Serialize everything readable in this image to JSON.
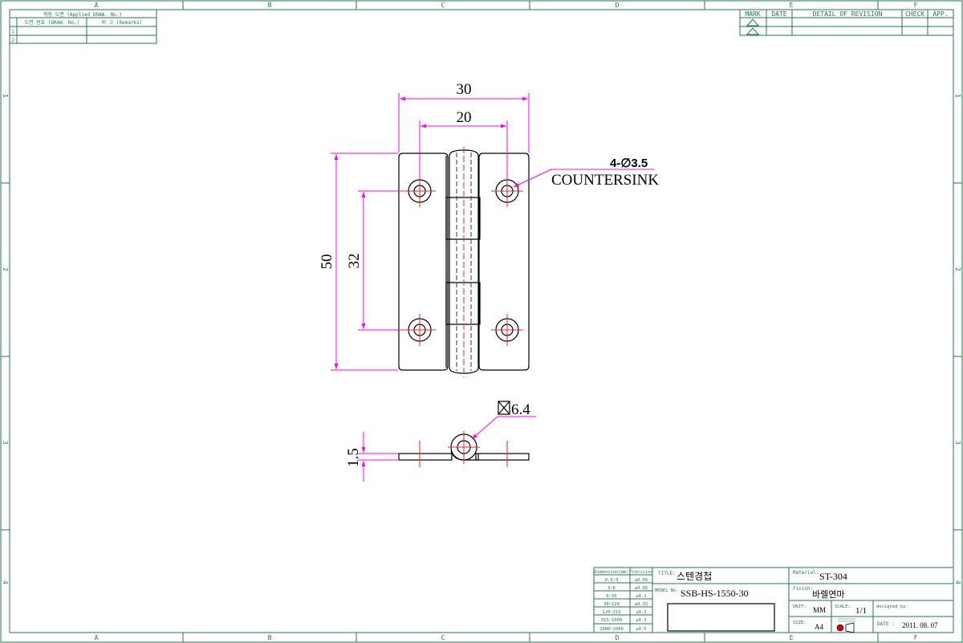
{
  "border": {
    "col_labels": [
      "A",
      "B",
      "C",
      "D",
      "E",
      "F"
    ],
    "row_labels": [
      "1",
      "2",
      "3",
      "4"
    ]
  },
  "applied_table": {
    "header": "적용 도면 (Applied DRAW. No.)",
    "col1": "도면 번호 (DRAW. No.)",
    "col2": "비 고 (Remarks)",
    "rows": [
      "1",
      "2"
    ]
  },
  "revision_table": {
    "headers": [
      "MARK",
      "DATE",
      "DETAIL OF REVISION",
      "CHECK",
      "APP."
    ]
  },
  "drawing": {
    "dim_width_outer": "30",
    "dim_width_inner": "20",
    "dim_height_outer": "50",
    "dim_height_inner": "32",
    "hole_callout": "4-∅3.5",
    "hole_note": "COUNTERSINK",
    "pin_callout": "6.4",
    "thickness": "1.5"
  },
  "tolerance_table": {
    "headers": [
      "Dimension(mm)",
      "Precision"
    ],
    "rows": [
      [
        "0.5~3",
        "±0.05"
      ],
      [
        "3~6",
        "±0.05"
      ],
      [
        "6~30",
        "±0.1"
      ],
      [
        "30~120",
        "±0.15"
      ],
      [
        "120~315",
        "±0.2"
      ],
      [
        "315~1000",
        "±0.3"
      ],
      [
        "1000~2000",
        "±0.5"
      ]
    ]
  },
  "title_block": {
    "title_label": "TITLE:",
    "title": "스텐경첩",
    "model_label": "MODEL No.",
    "model": "SSB-HS-1550-30",
    "material_label": "Material:",
    "material": "ST-304",
    "finish_label": "Finish:",
    "finish": "바렐연마",
    "unit_label": "UNIT:",
    "unit": "MM",
    "scale_label": "SCALE:",
    "scale": "1/1",
    "designed_label": "designed by:",
    "size_label": "SIZE:",
    "size": "A4",
    "date_label": "DATE :",
    "date": "2011. 08. 07"
  }
}
